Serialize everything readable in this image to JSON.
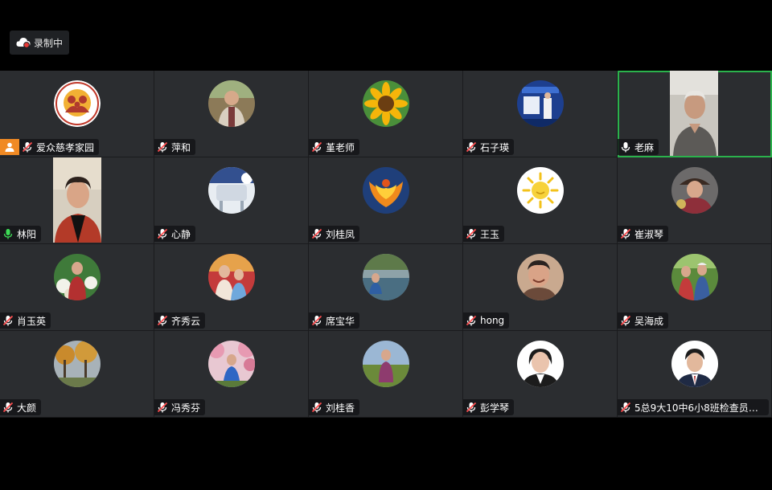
{
  "recording": {
    "label": "录制中",
    "icon": "cloud-record-icon",
    "dot_color": "#e53935"
  },
  "accent": {
    "active_border": "#2bb24c",
    "host_badge": "#f08a24",
    "mic_on": "#3ddc56"
  },
  "participants": [
    {
      "name": "爱众慈孝家园",
      "mic": "muted",
      "host": true,
      "avatar": "logo"
    },
    {
      "name": "萍和",
      "mic": "muted",
      "avatar": "photo-woman-outdoor"
    },
    {
      "name": "堇老师",
      "mic": "muted",
      "avatar": "photo-sunflower"
    },
    {
      "name": "石子瑛",
      "mic": "muted",
      "avatar": "photo-stage"
    },
    {
      "name": "老麻",
      "mic": "on-white",
      "active": true,
      "avatar": "video-man"
    },
    {
      "name": "林阳",
      "mic": "speaking",
      "avatar": "video-woman"
    },
    {
      "name": "心静",
      "mic": "muted",
      "avatar": "photo-room"
    },
    {
      "name": "刘桂凤",
      "mic": "muted",
      "avatar": "photo-phoenix"
    },
    {
      "name": "王玉",
      "mic": "muted",
      "avatar": "photo-sun"
    },
    {
      "name": "崔淑琴",
      "mic": "muted",
      "avatar": "photo-woman-hat"
    },
    {
      "name": "肖玉英",
      "mic": "muted",
      "avatar": "photo-flowers"
    },
    {
      "name": "齐秀云",
      "mic": "muted",
      "avatar": "photo-children"
    },
    {
      "name": "席宝华",
      "mic": "muted",
      "avatar": "photo-lake"
    },
    {
      "name": "hong",
      "mic": "muted",
      "avatar": "photo-smile"
    },
    {
      "name": "吴海成",
      "mic": "muted",
      "avatar": "photo-group"
    },
    {
      "name": "大颜",
      "mic": "muted",
      "avatar": "photo-trees"
    },
    {
      "name": "冯秀芬",
      "mic": "muted",
      "avatar": "photo-blossom"
    },
    {
      "name": "刘桂香",
      "mic": "muted",
      "avatar": "photo-woman-field"
    },
    {
      "name": "彭学琴",
      "mic": "muted",
      "avatar": "photo-portrait-woman"
    },
    {
      "name": "5总9大10中6小8班检查员陈...",
      "mic": "muted",
      "avatar": "photo-portrait-man"
    }
  ]
}
